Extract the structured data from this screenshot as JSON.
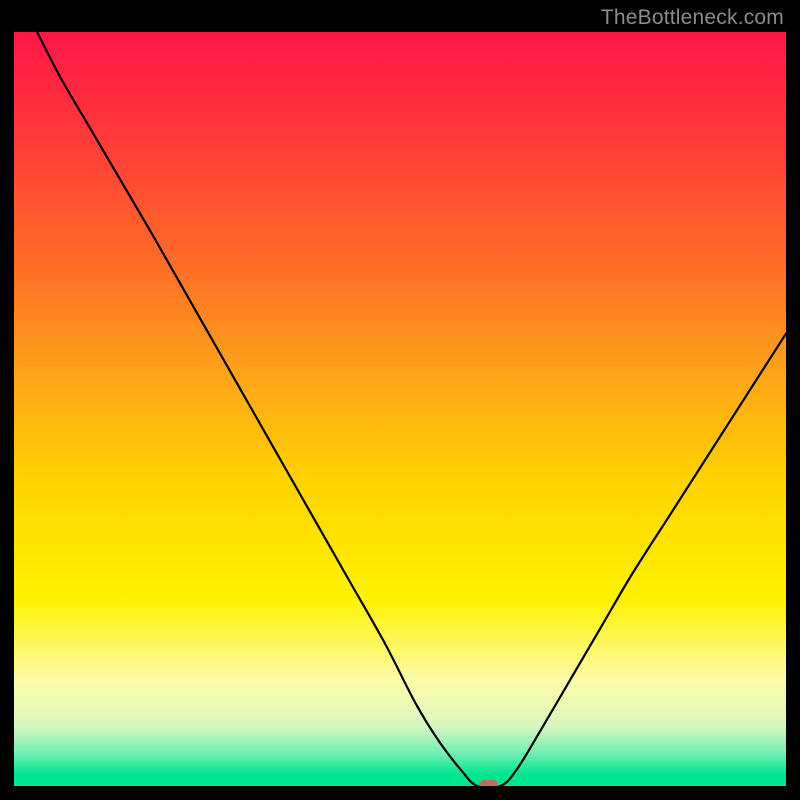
{
  "attribution": "TheBottleneck.com",
  "chart_data": {
    "type": "line",
    "title": "",
    "xlabel": "",
    "ylabel": "",
    "xlim": [
      0,
      100
    ],
    "ylim": [
      0,
      100
    ],
    "grid": false,
    "legend": false,
    "background_gradient": {
      "stops": [
        {
          "offset": 0.0,
          "color": "#ff1648"
        },
        {
          "offset": 0.14,
          "color": "#ff3a3a"
        },
        {
          "offset": 0.3,
          "color": "#ff6a28"
        },
        {
          "offset": 0.45,
          "color": "#ffa21a"
        },
        {
          "offset": 0.6,
          "color": "#ffd400"
        },
        {
          "offset": 0.75,
          "color": "#fff200"
        },
        {
          "offset": 0.86,
          "color": "#fdfca8"
        },
        {
          "offset": 0.92,
          "color": "#d9f8c0"
        },
        {
          "offset": 0.955,
          "color": "#77efb5"
        },
        {
          "offset": 0.985,
          "color": "#00e58f"
        },
        {
          "offset": 1.0,
          "color": "#00e58f"
        }
      ]
    },
    "series": [
      {
        "name": "bottleneck-curve",
        "color": "#000000",
        "x": [
          3,
          6,
          10,
          14,
          18,
          23,
          28,
          33,
          38,
          43,
          48,
          52,
          55,
          58,
          60,
          63,
          65,
          68,
          72,
          76,
          80,
          85,
          90,
          95,
          100
        ],
        "y": [
          100,
          94,
          87,
          80,
          73,
          64,
          55,
          46,
          37,
          28,
          19,
          11,
          6,
          2,
          0,
          0,
          2,
          7,
          14,
          21,
          28,
          36,
          44,
          52,
          60
        ]
      }
    ],
    "marker": {
      "name": "optimal-point",
      "x": 61.5,
      "y": 0,
      "color": "#c36a5e",
      "shape": "rounded-rect",
      "width_pct": 2.4,
      "height_pct": 1.6
    }
  }
}
